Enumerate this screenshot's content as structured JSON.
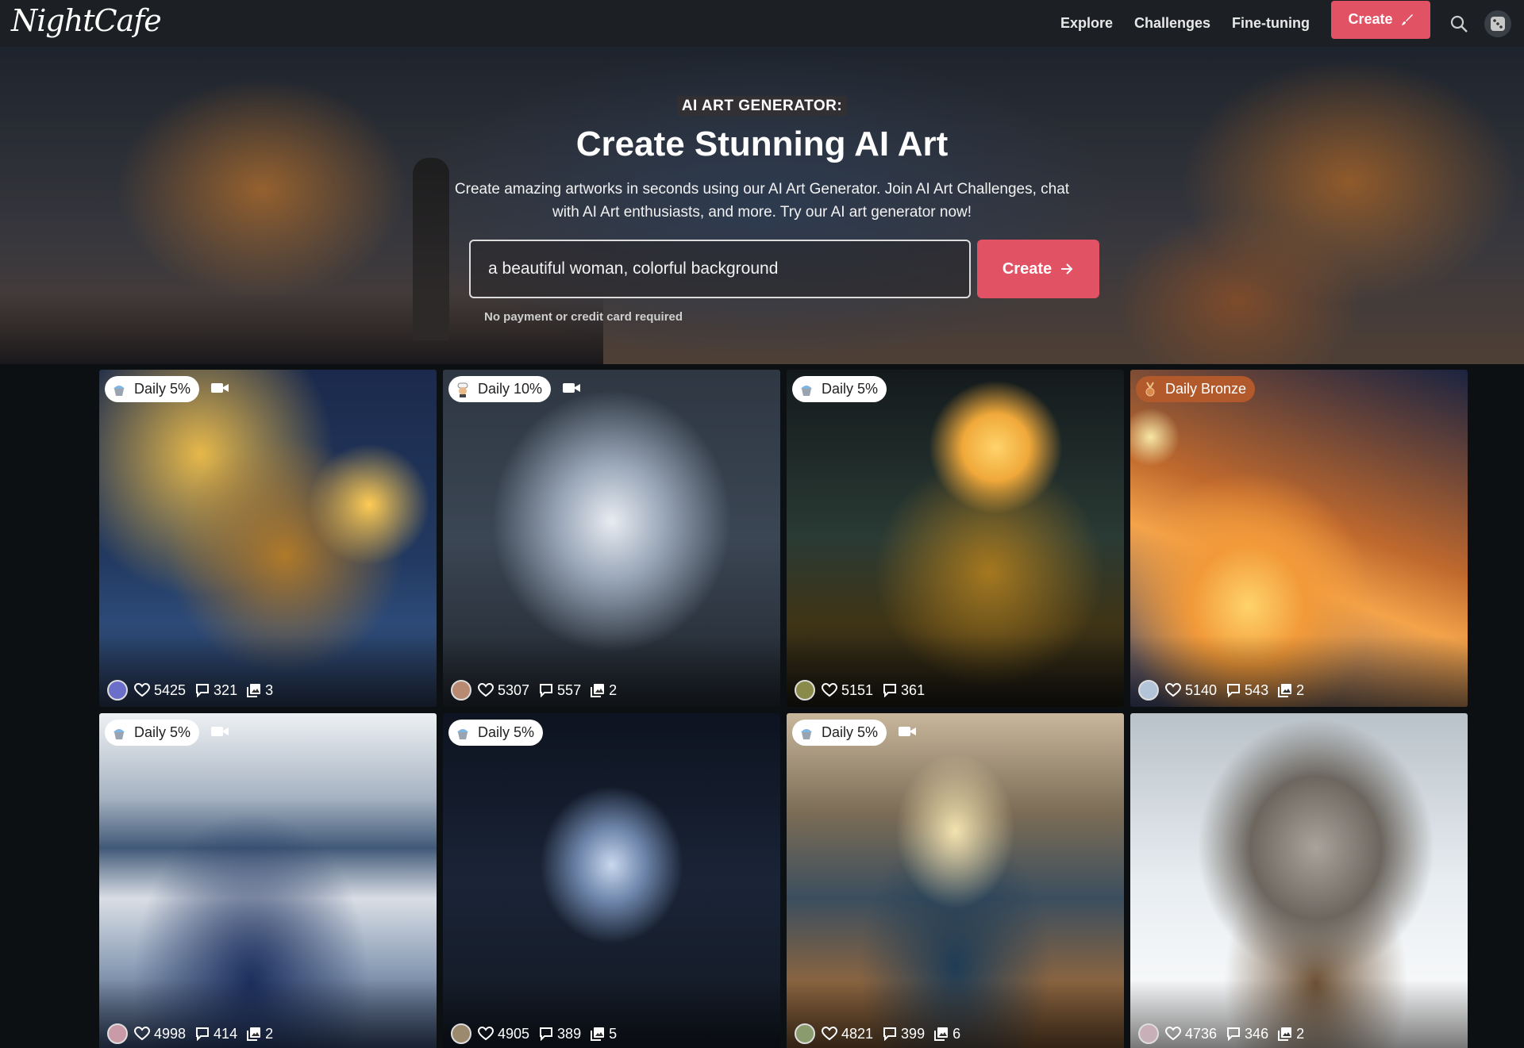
{
  "nav": {
    "logo": "NightCafe",
    "links": [
      "Explore",
      "Challenges",
      "Fine-tuning"
    ],
    "create_label": "Create"
  },
  "hero": {
    "eyebrow": "AI ART GENERATOR:",
    "title": "Create Stunning AI Art",
    "description": "Create amazing artworks in seconds using our AI Art Generator. Join AI Art Challenges, chat with AI Art enthusiasts, and more. Try our AI art generator now!",
    "prompt_value": "a beautiful woman, colorful background",
    "create_label": "Create",
    "note": "No payment or credit card required"
  },
  "colors": {
    "accent": "#e05264",
    "nav_bg": "#1c2024",
    "bronze": "#b35a2c"
  },
  "cards": [
    {
      "badge": "Daily 5%",
      "badge_icon": "cupcake-icon",
      "video": true,
      "likes": "5425",
      "comments": "321",
      "images": "3"
    },
    {
      "badge": "Daily 10%",
      "badge_icon": "chef-icon",
      "video": true,
      "likes": "5307",
      "comments": "557",
      "images": "2"
    },
    {
      "badge": "Daily 5%",
      "badge_icon": "cupcake-icon",
      "video": false,
      "likes": "5151",
      "comments": "361",
      "images": ""
    },
    {
      "badge": "Daily Bronze",
      "badge_icon": "medal-icon",
      "video": false,
      "likes": "5140",
      "comments": "543",
      "images": "2"
    },
    {
      "badge": "Daily 5%",
      "badge_icon": "cupcake-icon",
      "video": true,
      "likes": "4998",
      "comments": "414",
      "images": "2"
    },
    {
      "badge": "Daily 5%",
      "badge_icon": "cupcake-icon",
      "video": false,
      "likes": "4905",
      "comments": "389",
      "images": "5"
    },
    {
      "badge": "Daily 5%",
      "badge_icon": "cupcake-icon",
      "video": true,
      "likes": "4821",
      "comments": "399",
      "images": "6"
    },
    {
      "badge": "",
      "badge_icon": "",
      "video": false,
      "likes": "4736",
      "comments": "346",
      "images": "2"
    }
  ]
}
